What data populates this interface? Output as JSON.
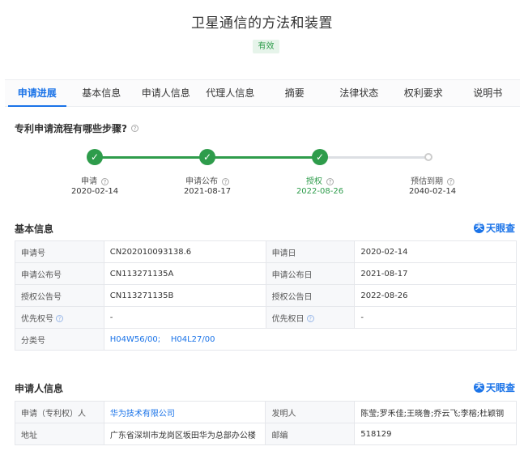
{
  "patent": {
    "title": "卫星通信的方法和装置",
    "status": "有效"
  },
  "tabs": [
    {
      "label": "申请进展"
    },
    {
      "label": "基本信息"
    },
    {
      "label": "申请人信息"
    },
    {
      "label": "代理人信息"
    },
    {
      "label": "摘要"
    },
    {
      "label": "法律状态"
    },
    {
      "label": "权利要求"
    },
    {
      "label": "说明书"
    }
  ],
  "progress": {
    "question": "专利申请流程有哪些步骤?",
    "steps": [
      {
        "label": "申请",
        "date": "2020-02-14",
        "done": true
      },
      {
        "label": "申请公布",
        "date": "2021-08-17",
        "done": true
      },
      {
        "label": "授权",
        "date": "2022-08-26",
        "done": true
      },
      {
        "label": "预估到期",
        "date": "2040-02-14",
        "done": false
      }
    ]
  },
  "brand": {
    "logo_char": "天",
    "name": "天眼查"
  },
  "basic_info": {
    "title": "基本信息",
    "app_no_label": "申请号",
    "app_no": "CN202010093138.6",
    "app_date_label": "申请日",
    "app_date": "2020-02-14",
    "pub_no_label": "申请公布号",
    "pub_no": "CN113271135A",
    "pub_date_label": "申请公布日",
    "pub_date": "2021-08-17",
    "grant_no_label": "授权公告号",
    "grant_no": "CN113271135B",
    "grant_date_label": "授权公告日",
    "grant_date": "2022-08-26",
    "priority_no_label": "优先权号",
    "priority_no": "-",
    "priority_date_label": "优先权日",
    "priority_date": "-",
    "class_label": "分类号",
    "class_1": "H04W56/00;",
    "class_2": "H04L27/00"
  },
  "applicant_info": {
    "title": "申请人信息",
    "applicant_label": "申请（专利权）人",
    "applicant": "华为技术有限公司",
    "inventor_label": "发明人",
    "inventor": "陈莹;罗禾佳;王晓鲁;乔云飞;李榕;杜颖钢",
    "address_label": "地址",
    "address": "广东省深圳市龙岗区坂田华为总部办公楼",
    "postcode_label": "邮编",
    "postcode": "518129"
  },
  "colors": {
    "accent": "#1a73e8",
    "success": "#2e9c4b"
  }
}
